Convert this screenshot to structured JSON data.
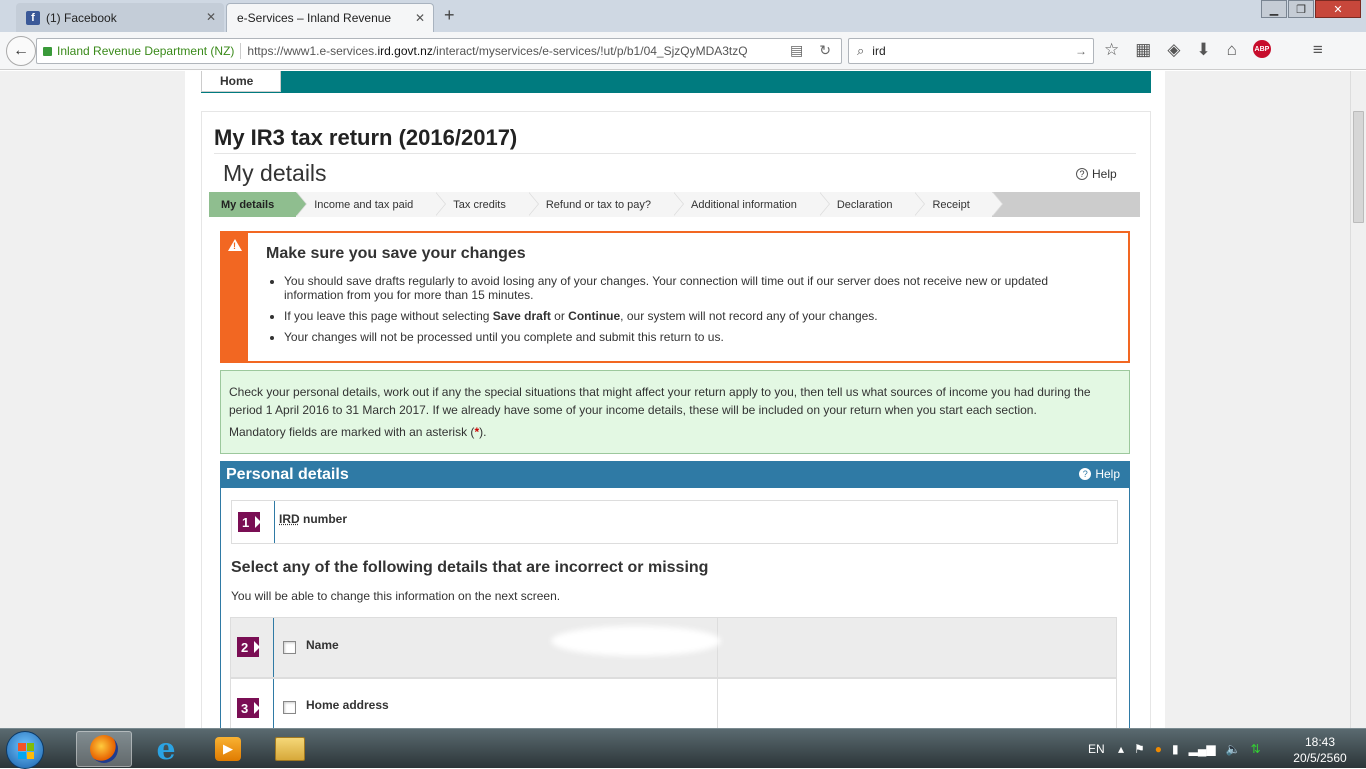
{
  "browser": {
    "tabs": [
      {
        "label": "(1) Facebook",
        "active": false
      },
      {
        "label": "e-Services – Inland Revenue",
        "active": true
      }
    ],
    "new_tab": "+",
    "url_org": "Inland Revenue Department (NZ)",
    "url_prefix": "https://www1.e-services.",
    "url_domain": "ird.govt.nz",
    "url_suffix": "/interact/myservices/e-services/!ut/p/b1/04_SjzQyMDA3tzQ",
    "search_value": "ird"
  },
  "site": {
    "home_tab": "Home"
  },
  "page": {
    "title": "My IR3 tax return (2016/2017)",
    "section_title": "My details",
    "help": "Help",
    "steps": [
      "My details",
      "Income and tax paid",
      "Tax credits",
      "Refund or tax to pay?",
      "Additional information",
      "Declaration",
      "Receipt"
    ],
    "warning": {
      "title": "Make sure you save your changes",
      "item1": "You should save drafts regularly to avoid losing any of your changes. Your connection will time out if our server does not receive new or updated information from you for more than 15 minutes.",
      "item2_a": "If you leave this page without selecting ",
      "item2_b": "Save draft",
      "item2_c": " or ",
      "item2_d": "Continue",
      "item2_e": ", our system will not record any of your changes.",
      "item3": "Your changes will not be processed until you complete and submit this return to us."
    },
    "info": {
      "line1": "Check your personal details, work out if any the special situations that might affect your return apply to you, then tell us what sources of income you had during the period 1 April 2016 to 31 March 2017. If we already have some of your income details, these will be included on your return when you start each section.",
      "mandatory_a": "Mandatory fields are marked with an asterisk (",
      "mandatory_ast": "*",
      "mandatory_b": ")."
    },
    "personal": {
      "header": "Personal details",
      "help": "Help",
      "q1_num": "1",
      "q1_label_abbr": "IRD",
      "q1_label_rest": " number",
      "select_heading": "Select any of the following details that are incorrect or missing",
      "select_sub": "You will be able to change this information on the next screen.",
      "q2_num": "2",
      "q2_label": "Name",
      "q3_num": "3",
      "q3_label": "Home address"
    }
  },
  "taskbar": {
    "lang": "EN",
    "time": "18:43",
    "date": "20/5/2560"
  }
}
